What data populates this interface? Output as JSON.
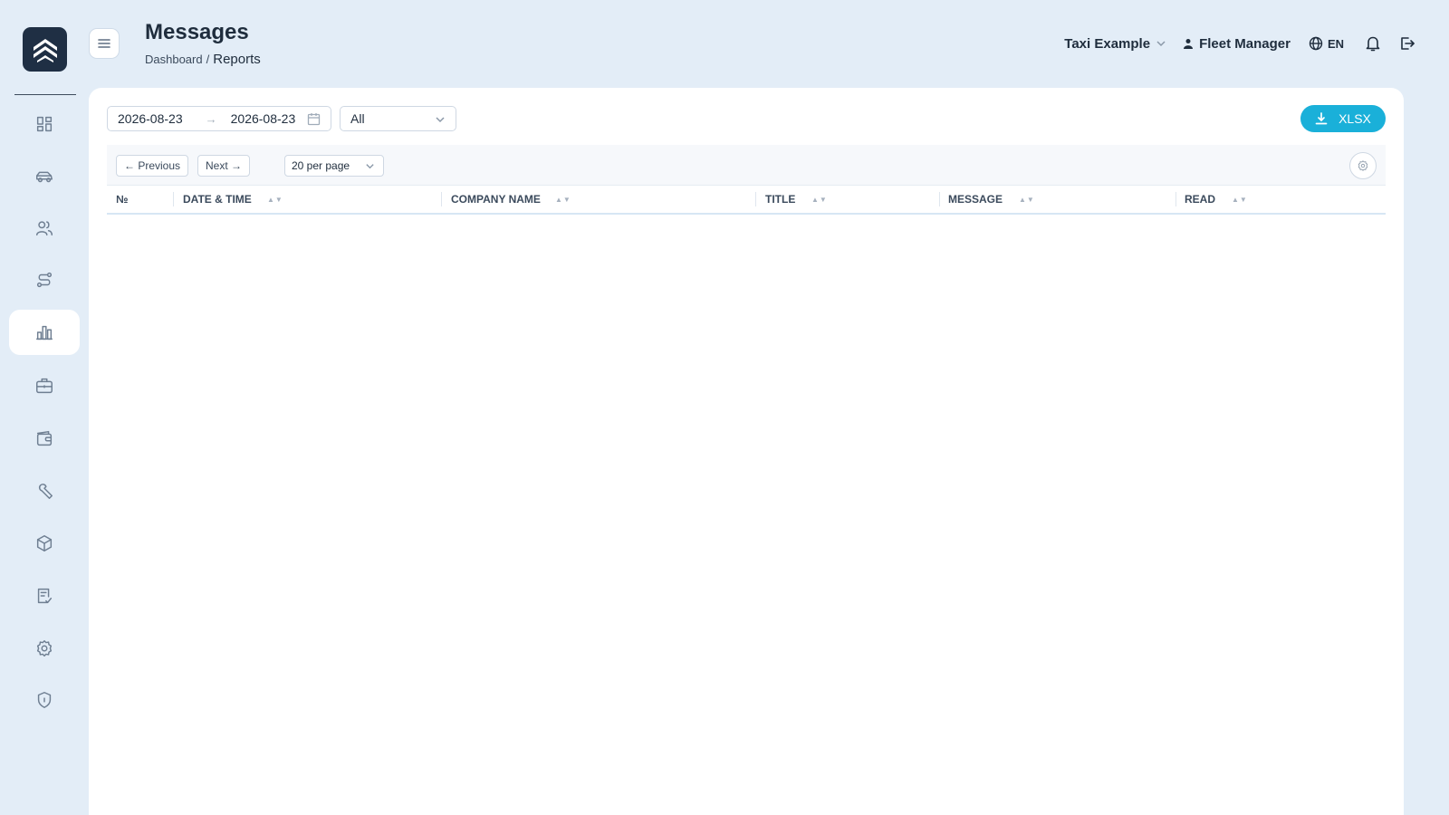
{
  "header": {
    "title": "Messages",
    "breadcrumb": {
      "root": "Dashboard",
      "separator": "/",
      "current": "Reports"
    },
    "company": "Taxi Example",
    "user": "Fleet Manager",
    "language": "EN"
  },
  "sidebar": {
    "items": [
      {
        "icon": "dashboard-icon",
        "active": false
      },
      {
        "icon": "car-icon",
        "active": false
      },
      {
        "icon": "users-icon",
        "active": false
      },
      {
        "icon": "route-icon",
        "active": false
      },
      {
        "icon": "bar-chart-icon",
        "active": true
      },
      {
        "icon": "briefcase-icon",
        "active": false
      },
      {
        "icon": "wallet-icon",
        "active": false
      },
      {
        "icon": "wrench-icon",
        "active": false
      },
      {
        "icon": "box-icon",
        "active": false
      },
      {
        "icon": "checklist-icon",
        "active": false
      },
      {
        "icon": "gear-icon",
        "active": false
      },
      {
        "icon": "shield-icon",
        "active": false
      }
    ]
  },
  "filters": {
    "date_from": "2026-08-23",
    "date_to": "2026-08-23",
    "range_separator": "→",
    "type_value": "All",
    "export_label": "XLSX"
  },
  "table": {
    "prev_label": "← Previous",
    "next_label": "Next →",
    "per_page_label": "20 per page",
    "columns": [
      "№",
      "Date & Time",
      "Company Name",
      "Title",
      "Message",
      "Read"
    ],
    "rows": []
  },
  "colors": {
    "background": "#e3edf7",
    "accent": "#1ab0d9",
    "logo": "#1f2f44"
  }
}
